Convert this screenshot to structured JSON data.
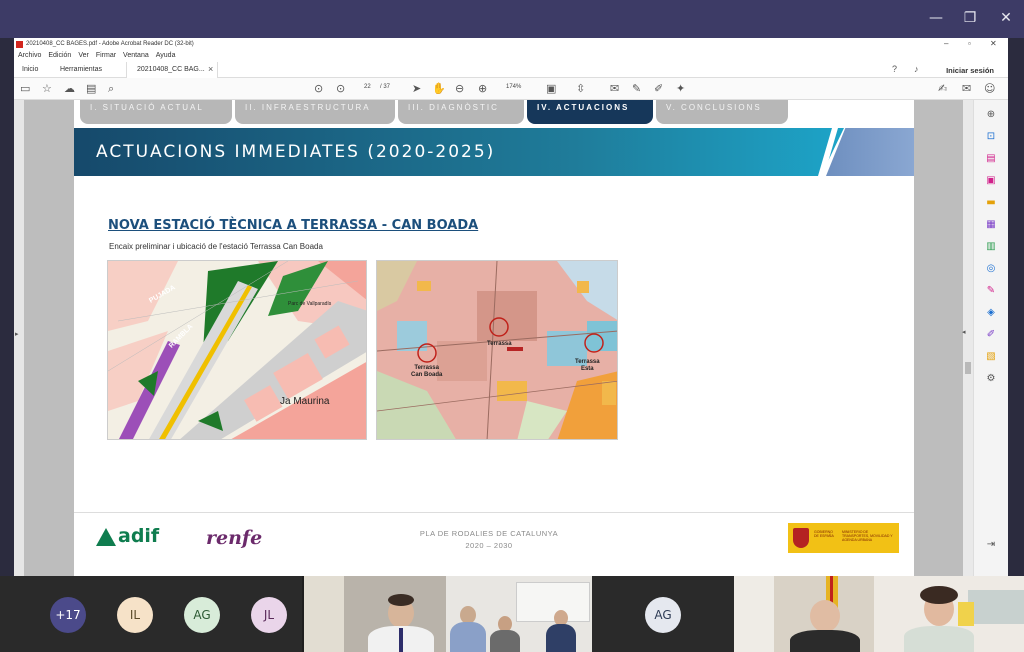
{
  "window": {
    "minimize_icon": "minimize-icon",
    "restore_icon": "restore-icon",
    "close_icon": "close-icon"
  },
  "acrobat": {
    "title": "20210408_CC BAGES.pdf - Adobe Acrobat Reader DC (32-bit)",
    "menu": [
      "Archivo",
      "Edición",
      "Ver",
      "Firmar",
      "Ventana",
      "Ayuda"
    ],
    "tabs": {
      "home": "Inicio",
      "tools": "Herramientas",
      "document": "20210408_CC BAG..."
    },
    "signin": "Iniciar sesión",
    "toolbar": {
      "page_current": "22",
      "page_total": "/ 37",
      "zoom": "174%"
    }
  },
  "slide": {
    "section_tabs": [
      {
        "label": "I. SITUACIÓ ACTUAL",
        "active": false
      },
      {
        "label": "II. INFRAESTRUCTURA",
        "active": false
      },
      {
        "label": "III. DIAGNÒSTIC",
        "active": false
      },
      {
        "label": "IV. ACTUACIONS",
        "active": true
      },
      {
        "label": "V. CONCLUSIONS",
        "active": false
      }
    ],
    "banner_title": "ACTUACIONS IMMEDIATES (2020-2025)",
    "section_title": "NOVA ESTACIÓ TÈCNICA A TERRASSA - CAN BOADA",
    "subtitle": "Encaix preliminar i ubicació de l'estació Terrassa Can Boada",
    "map1": {
      "label": "Ja Maurina",
      "street_1": "RAMBLA",
      "street_2": "PUJADA",
      "place": "Parc de Vallparadís"
    },
    "map2": {
      "label_1": "Terrassa\nCan Boada",
      "label_2": "Terrassa",
      "label_3": "Terrassa\nEsta"
    },
    "footer": {
      "line1": "PLA DE RODALIES DE CATALUNYA",
      "line2": "2020 – 2030",
      "adif": "adif",
      "renfe": "renfe",
      "gov_left": "GOBIERNO DE ESPAÑA",
      "gov_right": "MINISTERIO DE TRANSPORTES, MOVILIDAD Y AGENDA URBANA"
    }
  },
  "participants": {
    "overflow": "+17",
    "avatars": [
      {
        "initials": "IL",
        "bg": "#f6e2c8",
        "fg": "#5a4a2a"
      },
      {
        "initials": "AG",
        "bg": "#d8ecd9",
        "fg": "#2c5a33"
      },
      {
        "initials": "JL",
        "bg": "#ead5ea",
        "fg": "#5a2a5a"
      },
      {
        "initials": "AG",
        "bg": "#e5e8ef",
        "fg": "#2d3b55"
      }
    ]
  },
  "colors": {
    "call_title": "#3d3b66",
    "banner": "#16496b",
    "active_tab": "#16375a",
    "heading": "#1c4f7c"
  }
}
